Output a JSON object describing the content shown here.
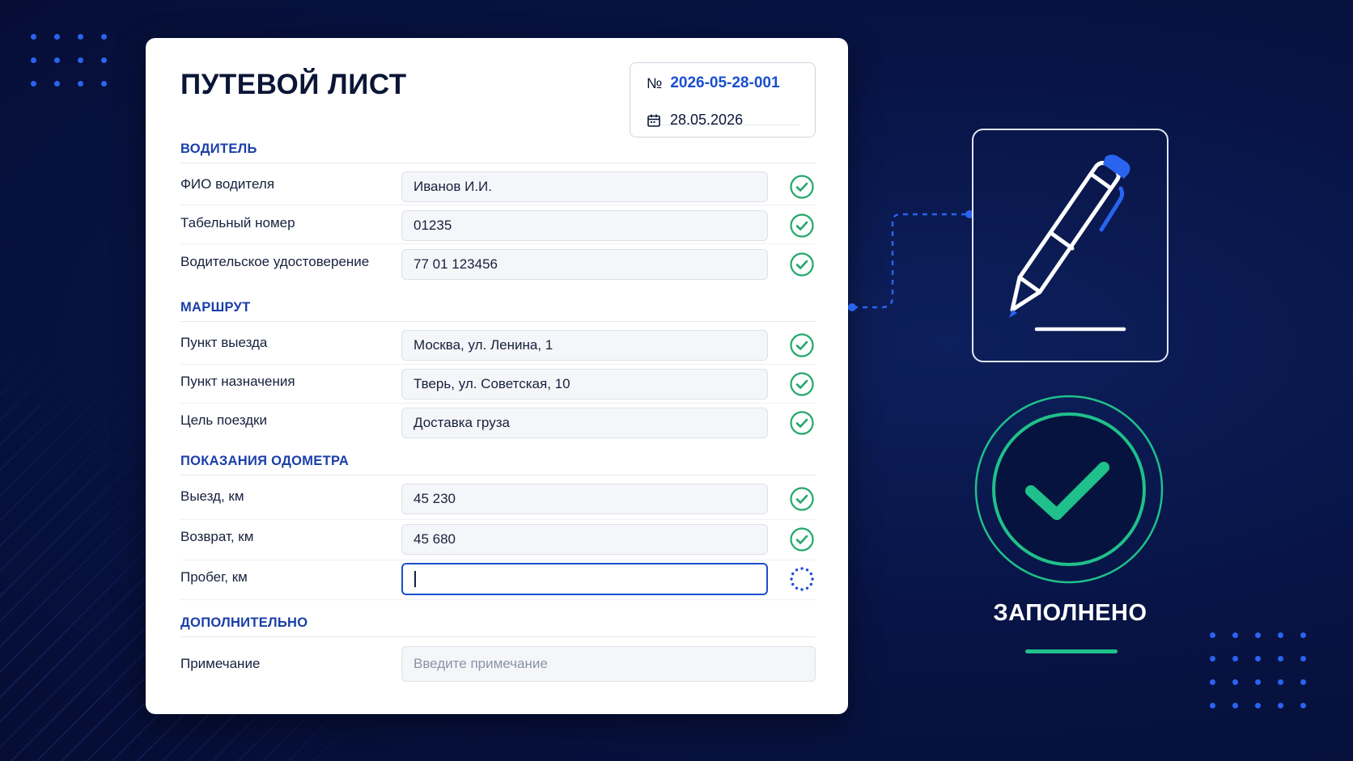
{
  "document": {
    "title": "ПУТЕВОЙ ЛИСТ",
    "number_sign": "№",
    "number": "2026-05-28-001",
    "date": "28.05.2026"
  },
  "sections": {
    "driver": {
      "title": "ВОДИТЕЛЬ",
      "fields": [
        {
          "label": "ФИО водителя",
          "value": "Иванов И.И.",
          "status": "check-circle-icon"
        },
        {
          "label": "Табельный номер",
          "value": "01235",
          "status": "check-circle-icon"
        },
        {
          "label": "Водительское удостоверение",
          "value": "77 01 123456",
          "status": "check-circle-icon"
        }
      ]
    },
    "route": {
      "title": "МАРШРУТ",
      "fields": [
        {
          "label": "Пункт выезда",
          "value": "Москва, ул. Ленина, 1",
          "status": "check-circle-icon"
        },
        {
          "label": "Пункт назначения",
          "value": "Тверь, ул. Советская, 10",
          "status": "check-circle-icon"
        },
        {
          "label": "Цель поездки",
          "value": "Доставка груза",
          "status": "check-circle-icon"
        }
      ]
    },
    "odometer": {
      "title": "ПОКАЗАНИЯ ОДОМЕТРА",
      "fields": [
        {
          "label": "Выезд, км",
          "value": "45 230",
          "status": "check-circle-icon"
        },
        {
          "label": "Возврат, км",
          "value": "45 680",
          "status": "check-circle-icon"
        },
        {
          "label": "Пробег, км",
          "value": "",
          "status": "loading-spinner-icon"
        }
      ]
    },
    "extra": {
      "title": "ДОПОЛНИТЕЛЬНО",
      "fields": [
        {
          "label": "Примечание",
          "value": "",
          "placeholder": "Введите примечание"
        }
      ]
    }
  },
  "side_panel": {
    "pen_icon": "pen-signature-icon",
    "badge_icon": "big-checkmark-icon",
    "status_label": "ЗАПОЛНЕНО"
  },
  "colors": {
    "background": "#081446",
    "accent_blue": "#1a4fd0",
    "section_blue": "#1a3fa8",
    "success_green": "#1fc08a",
    "check_green": "#22a86a",
    "dot_blue": "#2a63f0"
  }
}
